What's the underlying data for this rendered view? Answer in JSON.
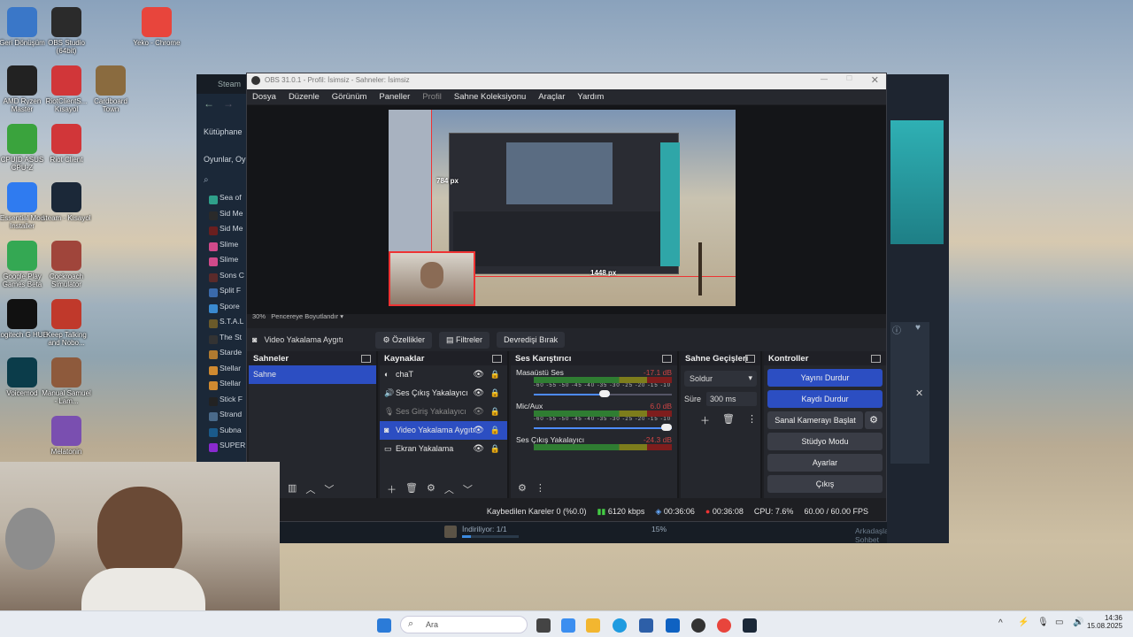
{
  "desktop": {
    "icons": [
      {
        "label": "Geri Dönüşüm",
        "color": "#3a77c8"
      },
      {
        "label": "OBS Studio (64bit)",
        "color": "#2b2b2b"
      },
      {
        "label": "Yeko - Chrome",
        "color": "#e8453c"
      },
      {
        "label": "AMD Ryzen Master",
        "color": "#222"
      },
      {
        "label": "RiotClientS... Kısayol",
        "color": "#d13639"
      },
      {
        "label": "Cardboard Town",
        "color": "#8a6b3f"
      },
      {
        "label": "CPUID ASUS CPU-Z",
        "color": "#3aa33d"
      },
      {
        "label": "Riot Client",
        "color": "#d13639"
      },
      {
        "label": "Essential Mod Installer",
        "color": "#2f7bf0"
      },
      {
        "label": "steam - Kısayol",
        "color": "#1b2838"
      },
      {
        "label": "Google Play Games Beta",
        "color": "#34a853"
      },
      {
        "label": "Cockroach Simulator",
        "color": "#a0453b"
      },
      {
        "label": "Logitech G HUB",
        "color": "#111"
      },
      {
        "label": "Keep Talking and Nobo...",
        "color": "#c0392b"
      },
      {
        "label": "Voicemod",
        "color": "#0b3c4a"
      },
      {
        "label": "Manual Samuel - Lam...",
        "color": "#8e5a3c"
      },
      {
        "label": "Melatonin",
        "color": "#7a4fb0"
      }
    ]
  },
  "steam": {
    "title": "Steam",
    "library_label": "Kütüphane",
    "games_label": "Oyunlar, Oy",
    "games": [
      {
        "name": "Sea of",
        "color": "#2fa08a"
      },
      {
        "name": "Sid Me",
        "color": "#2a2a2a"
      },
      {
        "name": "Sid Me",
        "color": "#6a1f1f"
      },
      {
        "name": "Slime",
        "color": "#d04a8a"
      },
      {
        "name": "Slime",
        "color": "#d04a8a"
      },
      {
        "name": "Sons C",
        "color": "#5a2a2a"
      },
      {
        "name": "Split F",
        "color": "#3a6aaa"
      },
      {
        "name": "Spore",
        "color": "#3a8ad0"
      },
      {
        "name": "S.T.A.L",
        "color": "#6a5a2a"
      },
      {
        "name": "The St",
        "color": "#333"
      },
      {
        "name": "Starde",
        "color": "#b07a30"
      },
      {
        "name": "Stellar",
        "color": "#d08a30"
      },
      {
        "name": "Stellar",
        "color": "#d08a30"
      },
      {
        "name": "Stick F",
        "color": "#222"
      },
      {
        "name": "Strand",
        "color": "#4a6a8a"
      },
      {
        "name": "Subna",
        "color": "#1a5a8a"
      },
      {
        "name": "SUPER",
        "color": "#8a2ad0"
      }
    ],
    "friends_label": "Arkadaşlar ve Sohbet",
    "download_label": "İndiriliyor: 1/1",
    "download_percent": "15%",
    "download_progress": 0.15
  },
  "obs": {
    "title": "OBS 31.0.1 - Profil: İsimsiz - Sahneler: İsimsiz",
    "menu": [
      "Dosya",
      "Düzenle",
      "Görünüm",
      "Paneller",
      "Profil",
      "Sahne Koleksiyonu",
      "Araçlar",
      "Yardım"
    ],
    "preview": {
      "zoom": "30%",
      "fit_label": "Pencereye Boyutlandır",
      "dim_height": "784 px",
      "dim_width": "1448 px"
    },
    "toolbar": {
      "source_name": "Video Yakalama Aygıtı",
      "properties": "Özellikler",
      "filters": "Filtreler",
      "deactivate": "Devredişi Bırak"
    },
    "scenes": {
      "title": "Sahneler",
      "items": [
        "Sahne"
      ]
    },
    "sources": {
      "title": "Kaynaklar",
      "items": [
        {
          "name": "chaT",
          "selected": false,
          "dim": false
        },
        {
          "name": "Ses Çıkış Yakalayıcı",
          "selected": false,
          "dim": false
        },
        {
          "name": "Ses Giriş Yakalayıcı",
          "selected": false,
          "dim": true
        },
        {
          "name": "Video Yakalama Aygıtı",
          "selected": true,
          "dim": false
        },
        {
          "name": "Ekran Yakalama",
          "selected": false,
          "dim": false
        }
      ]
    },
    "mixer": {
      "title": "Ses Karıştırıcı",
      "ticks": "-60 -55 -50 -45 -40 -35 -30 -25 -20 -15 -10 -5 0",
      "channels": [
        {
          "name": "Masaüstü Ses",
          "db": "-17.1 dB",
          "level": 0.55
        },
        {
          "name": "Mic/Aux",
          "db": "6.0 dB",
          "level": 1.0
        },
        {
          "name": "Ses Çıkış Yakalayıcı",
          "db": "-24.3 dB",
          "level": 0.0
        }
      ]
    },
    "transitions": {
      "title": "Sahne Geçişleri",
      "type": "Soldur",
      "duration_label": "Süre",
      "duration": "300 ms"
    },
    "controls": {
      "title": "Kontroller",
      "stop_stream": "Yayını Durdur",
      "stop_record": "Kaydı Durdur",
      "virtual_cam": "Sanal Kamerayı Başlat",
      "studio_mode": "Stüdyo Modu",
      "settings": "Ayarlar",
      "exit": "Çıkış"
    },
    "status": {
      "dropped": "Kaybedilen Kareler 0 (%0.0)",
      "bitrate": "6120 kbps",
      "stream_time": "00:36:06",
      "record_time": "00:36:08",
      "cpu": "CPU: 7.6%",
      "fps": "60.00 / 60.00 FPS"
    }
  },
  "taskbar": {
    "search_placeholder": "Ara",
    "time": "14:36",
    "date": "15.08.2025"
  }
}
